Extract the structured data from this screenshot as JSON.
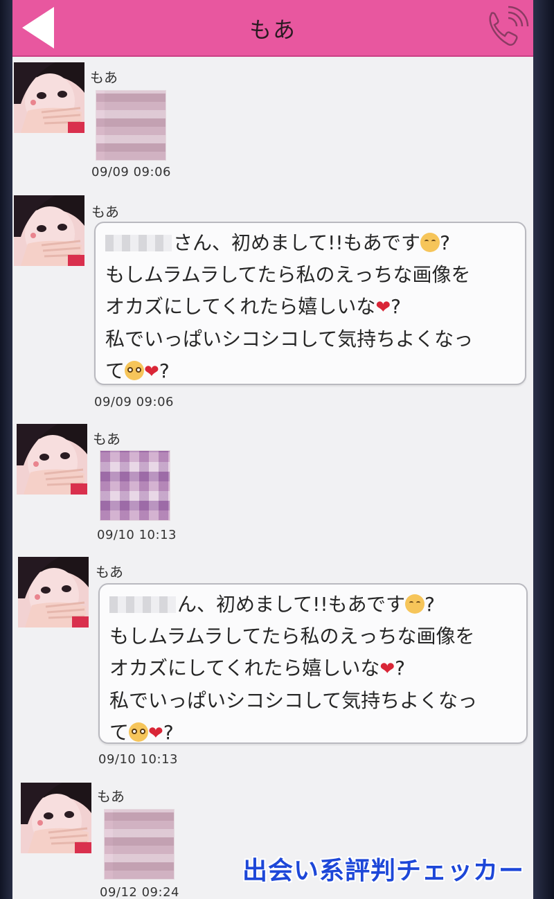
{
  "header": {
    "title": "もあ",
    "back_icon": "back-arrow-icon",
    "call_icon": "phone-call-icon",
    "accent_color": "#e8579f"
  },
  "messages": [
    {
      "sender": "もあ",
      "type": "image",
      "time": "09/09 09:06"
    },
    {
      "sender": "もあ",
      "type": "text",
      "time": "09/09 09:06",
      "lines": [
        "さん、初めまして!!もあです",
        "もしムラムラしてたら私のえっちな画像を",
        "オカズにしてくれたら嬉しいな",
        "私でいっぱいシコシコして気持ちよくなっ",
        "て"
      ],
      "suffix": "?"
    },
    {
      "sender": "もあ",
      "type": "image",
      "time": "09/10 10:13"
    },
    {
      "sender": "もあ",
      "type": "text",
      "time": "09/10 10:13",
      "lines": [
        "ん、初めまして!!もあです",
        "もしムラムラしてたら私のえっちな画像を",
        "オカズにしてくれたら嬉しいな",
        "私でいっぱいシコシコして気持ちよくなっ",
        "て"
      ],
      "suffix": "?"
    },
    {
      "sender": "もあ",
      "type": "image",
      "time": "09/12 09:24"
    }
  ],
  "watermark": "出会い系評判チェッカー"
}
